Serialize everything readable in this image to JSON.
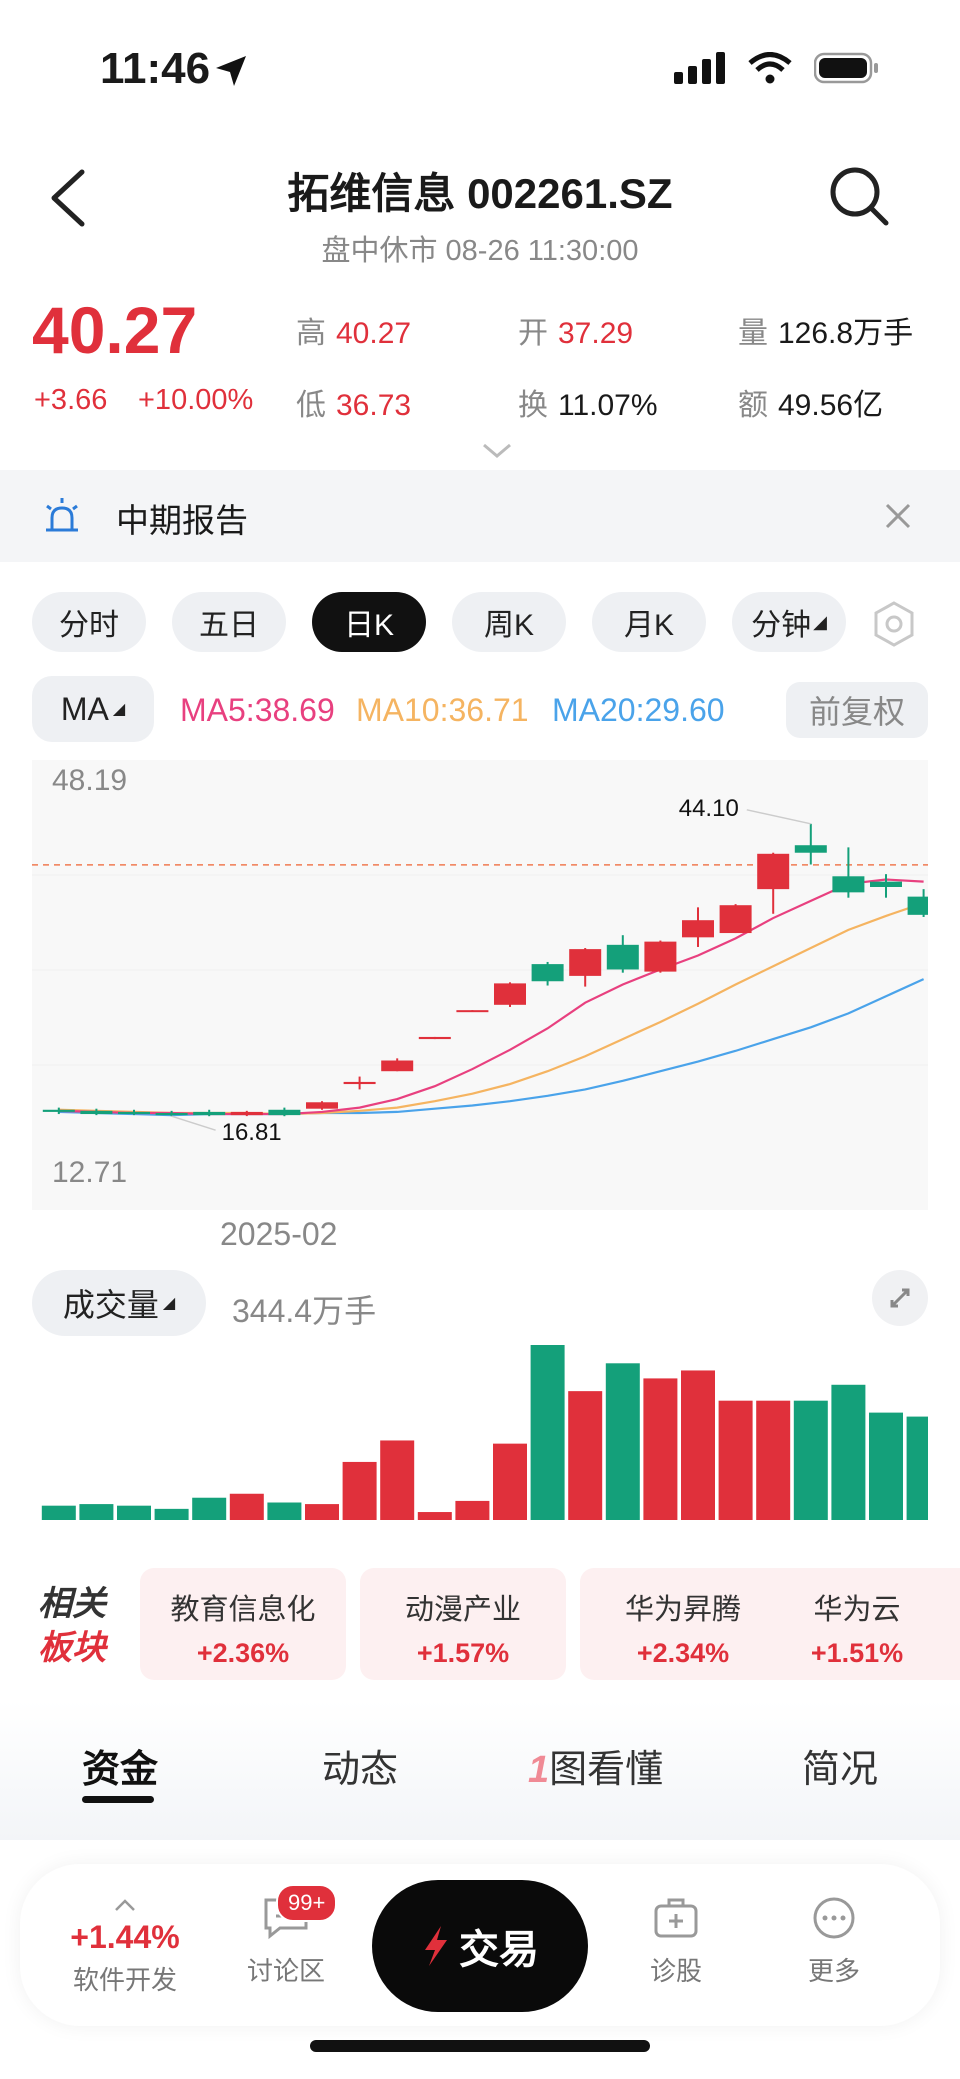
{
  "status": {
    "time": "11:46"
  },
  "header": {
    "title": "拓维信息 002261.SZ",
    "subtitle": "盘中休市 08-26 11:30:00"
  },
  "quote": {
    "price": "40.27",
    "change": "+3.66",
    "change_pct": "+10.00%",
    "high_label": "高",
    "high": "40.27",
    "open_label": "开",
    "open": "37.29",
    "volume_label": "量",
    "volume": "126.8万手",
    "low_label": "低",
    "low": "36.73",
    "turnover_label": "换",
    "turnover": "11.07%",
    "amount_label": "额",
    "amount": "49.56亿"
  },
  "banner": {
    "text": "中期报告"
  },
  "tabs": [
    "分时",
    "五日",
    "日K",
    "周K",
    "月K",
    "分钟"
  ],
  "active_tab": "日K",
  "ma_bar": {
    "selector": "MA",
    "ma5": "MA5:38.69",
    "ma10": "MA10:36.71",
    "ma20": "MA20:29.60",
    "adjust": "前复权"
  },
  "colors": {
    "up": "#e0303b",
    "down": "#14a07a",
    "ma5": "#e8407f",
    "ma10": "#f5b461",
    "ma20": "#4aa3ea"
  },
  "chart_data": {
    "type": "candlestick",
    "y_max_label": "48.19",
    "y_min_label": "12.71",
    "x_tick_label": "2025-02",
    "ylim": [
      12.71,
      48.19
    ],
    "high_annotation": "44.10",
    "low_annotation": "16.81",
    "reference_line": 40.27,
    "candles": [
      {
        "o": 17.4,
        "c": 17.2,
        "h": 17.6,
        "l": 17.0
      },
      {
        "o": 17.3,
        "c": 17.0,
        "h": 17.5,
        "l": 16.9
      },
      {
        "o": 17.2,
        "c": 17.0,
        "h": 17.4,
        "l": 16.9
      },
      {
        "o": 17.1,
        "c": 16.9,
        "h": 17.3,
        "l": 16.8
      },
      {
        "o": 17.2,
        "c": 16.9,
        "h": 17.4,
        "l": 16.8
      },
      {
        "o": 16.9,
        "c": 17.2,
        "h": 17.3,
        "l": 16.81
      },
      {
        "o": 17.4,
        "c": 16.9,
        "h": 17.6,
        "l": 16.8
      },
      {
        "o": 17.5,
        "c": 18.1,
        "h": 18.2,
        "l": 17.4
      },
      {
        "o": 19.8,
        "c": 20.0,
        "h": 20.5,
        "l": 19.3
      },
      {
        "o": 21.0,
        "c": 22.0,
        "h": 22.2,
        "l": 21.0
      },
      {
        "o": 24.0,
        "c": 24.2,
        "h": 24.2,
        "l": 24.0
      },
      {
        "o": 26.6,
        "c": 26.7,
        "h": 26.7,
        "l": 26.6
      },
      {
        "o": 27.2,
        "c": 29.2,
        "h": 29.3,
        "l": 27.0
      },
      {
        "o": 31.0,
        "c": 29.4,
        "h": 31.2,
        "l": 29.0
      },
      {
        "o": 29.9,
        "c": 32.4,
        "h": 32.5,
        "l": 28.9
      },
      {
        "o": 32.8,
        "c": 30.5,
        "h": 33.7,
        "l": 30.2
      },
      {
        "o": 30.3,
        "c": 33.1,
        "h": 33.2,
        "l": 30.2
      },
      {
        "o": 33.5,
        "c": 35.1,
        "h": 36.3,
        "l": 32.6
      },
      {
        "o": 33.9,
        "c": 36.5,
        "h": 36.6,
        "l": 33.9
      },
      {
        "o": 38.0,
        "c": 41.3,
        "h": 41.4,
        "l": 35.7
      },
      {
        "o": 42.1,
        "c": 41.4,
        "h": 44.1,
        "l": 40.3
      },
      {
        "o": 39.2,
        "c": 37.7,
        "h": 41.9,
        "l": 37.2
      },
      {
        "o": 38.7,
        "c": 38.2,
        "h": 39.4,
        "l": 37.2
      },
      {
        "o": 37.3,
        "c": 35.6,
        "h": 38.0,
        "l": 35.4
      }
    ],
    "ma5": [
      17.3,
      17.2,
      17.1,
      17.1,
      17.0,
      17.0,
      17.0,
      17.2,
      17.6,
      18.4,
      19.6,
      21.2,
      23.0,
      25.0,
      27.4,
      29.1,
      30.5,
      31.8,
      33.4,
      35.3,
      36.9,
      38.5,
      38.9,
      38.7
    ],
    "ma10": [
      17.4,
      17.3,
      17.2,
      17.1,
      17.1,
      17.1,
      17.0,
      17.1,
      17.3,
      17.6,
      18.2,
      18.9,
      19.8,
      21.0,
      22.4,
      24.0,
      25.6,
      27.3,
      29.1,
      30.8,
      32.5,
      34.2,
      35.5,
      36.7
    ],
    "ma20": [
      17.2,
      17.1,
      17.0,
      16.9,
      17.0,
      17.0,
      17.0,
      17.1,
      17.1,
      17.2,
      17.5,
      17.8,
      18.2,
      18.7,
      19.3,
      20.1,
      21.0,
      21.9,
      22.9,
      24.0,
      25.1,
      26.4,
      28.0,
      29.6
    ],
    "volume_label": "成交量",
    "volume_value": "344.4万手",
    "volume": [
      18,
      20,
      18,
      14,
      28,
      33,
      22,
      20,
      73,
      100,
      10,
      24,
      96,
      220,
      162,
      197,
      178,
      188,
      150,
      150,
      150,
      170,
      135,
      130
    ]
  },
  "sectors_label": [
    "相关",
    "板块"
  ],
  "sectors": [
    {
      "name": "教育信息化",
      "pct": "+2.36%"
    },
    {
      "name": "动漫产业",
      "pct": "+1.57%"
    },
    {
      "name": "华为昇腾",
      "pct": "+2.34%"
    },
    {
      "name": "华为云",
      "pct": "+1.51%"
    }
  ],
  "bottom_tabs": [
    "资金",
    "动态",
    "图看懂",
    "简况"
  ],
  "bottom_tabs_active": "资金",
  "bottom_bar": {
    "sector_change": "+1.44%",
    "sector_name": "软件开发",
    "forum": "讨论区",
    "forum_badge": "99+",
    "trade": "交易",
    "diagnose": "诊股",
    "more": "更多"
  }
}
